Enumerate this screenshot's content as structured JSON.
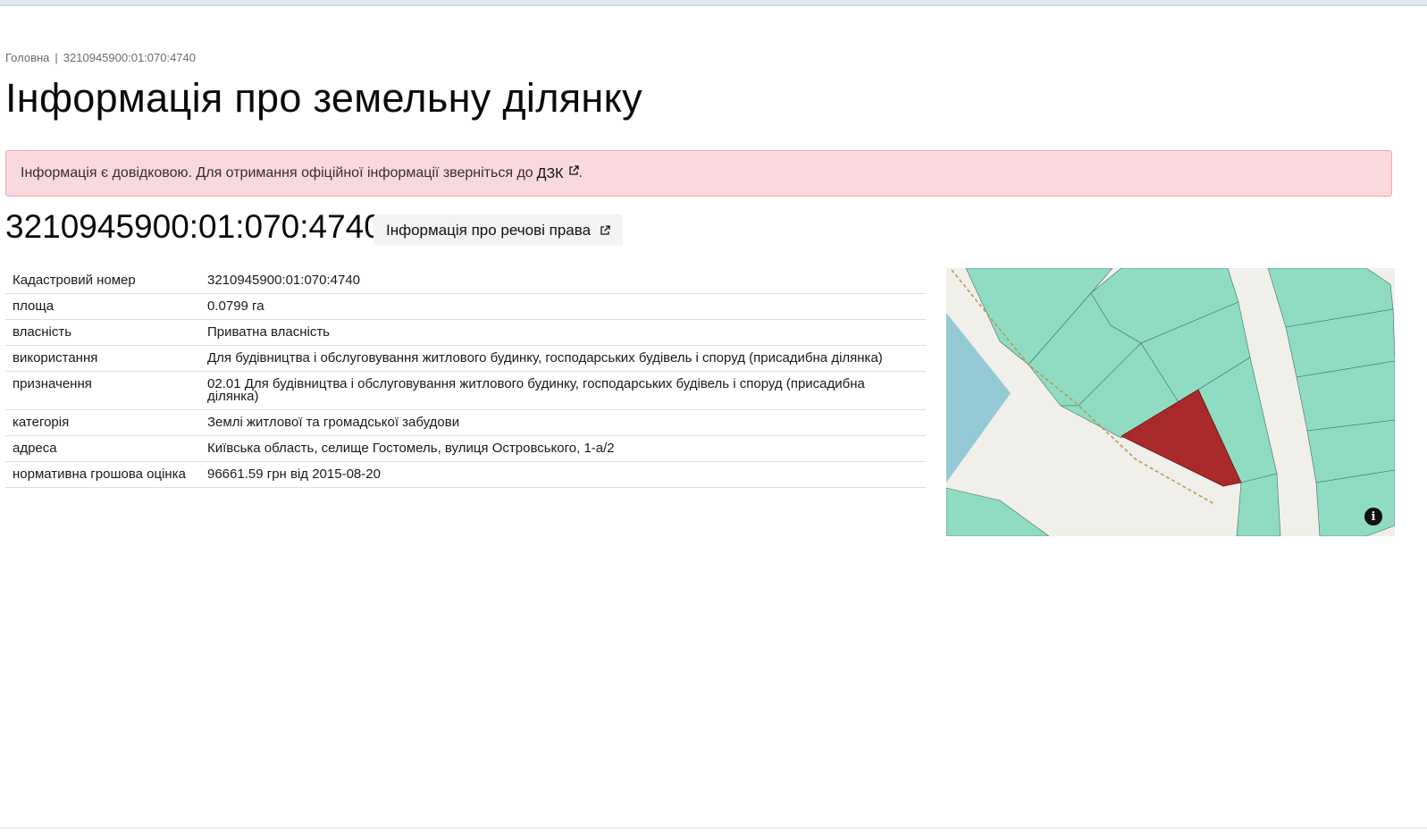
{
  "breadcrumb": {
    "home": "Головна",
    "current": "3210945900:01:070:4740"
  },
  "page_title": "Інформація про земельну ділянку",
  "alert": {
    "text": "Інформація є довідковою. Для отримання офіційної інформації зверніться до",
    "link": "ДЗК",
    "suffix": "."
  },
  "parcel": {
    "number": "3210945900:01:070:4740",
    "rights_button": "Інформація про речові права"
  },
  "rows": [
    {
      "key": "Кадастровий номер",
      "value": "3210945900:01:070:4740"
    },
    {
      "key": "площа",
      "value": "0.0799 га"
    },
    {
      "key": "власність",
      "value": "Приватна власність"
    },
    {
      "key": "використання",
      "value": "Для будівництва і обслуговування житлового будинку, господарських будівель і споруд (присадибна ділянка)"
    },
    {
      "key": "призначення",
      "value": "02.01 Для будівництва і обслуговування житлового будинку, господарських будівель і споруд (присадибна ділянка)"
    },
    {
      "key": "категорія",
      "value": "Землі житлової та громадської забудови"
    },
    {
      "key": "адреса",
      "value": "Київська область, селище Гостомель, вулиця Островського, 1-а/2"
    },
    {
      "key": "нормативна грошова оцінка",
      "value": "96661.59 грн від 2015-08-20"
    }
  ],
  "map": {
    "info_icon": "info-icon",
    "colors": {
      "parcel": "#a82a2a",
      "neighbor": "#8fdcc2",
      "water": "#95c9d6",
      "road": "#f1efe9",
      "road_line": "#b79a55"
    }
  },
  "icons": {
    "external": "external-link-icon"
  }
}
